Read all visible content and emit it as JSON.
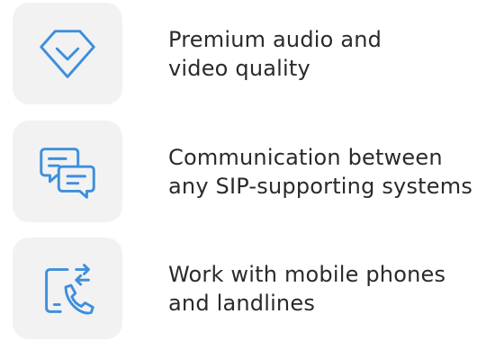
{
  "accent_color": "#3d8fdc",
  "tile_color": "#f2f2f3",
  "features": [
    {
      "icon": "diamond-icon",
      "line1": "Premium audio and",
      "line2": "video quality"
    },
    {
      "icon": "chat-bubbles-icon",
      "line1": "Communication between",
      "line2": "any SIP-supporting systems"
    },
    {
      "icon": "mobile-phone-handset-icon",
      "line1": "Work with mobile phones",
      "line2": "and landlines"
    }
  ]
}
